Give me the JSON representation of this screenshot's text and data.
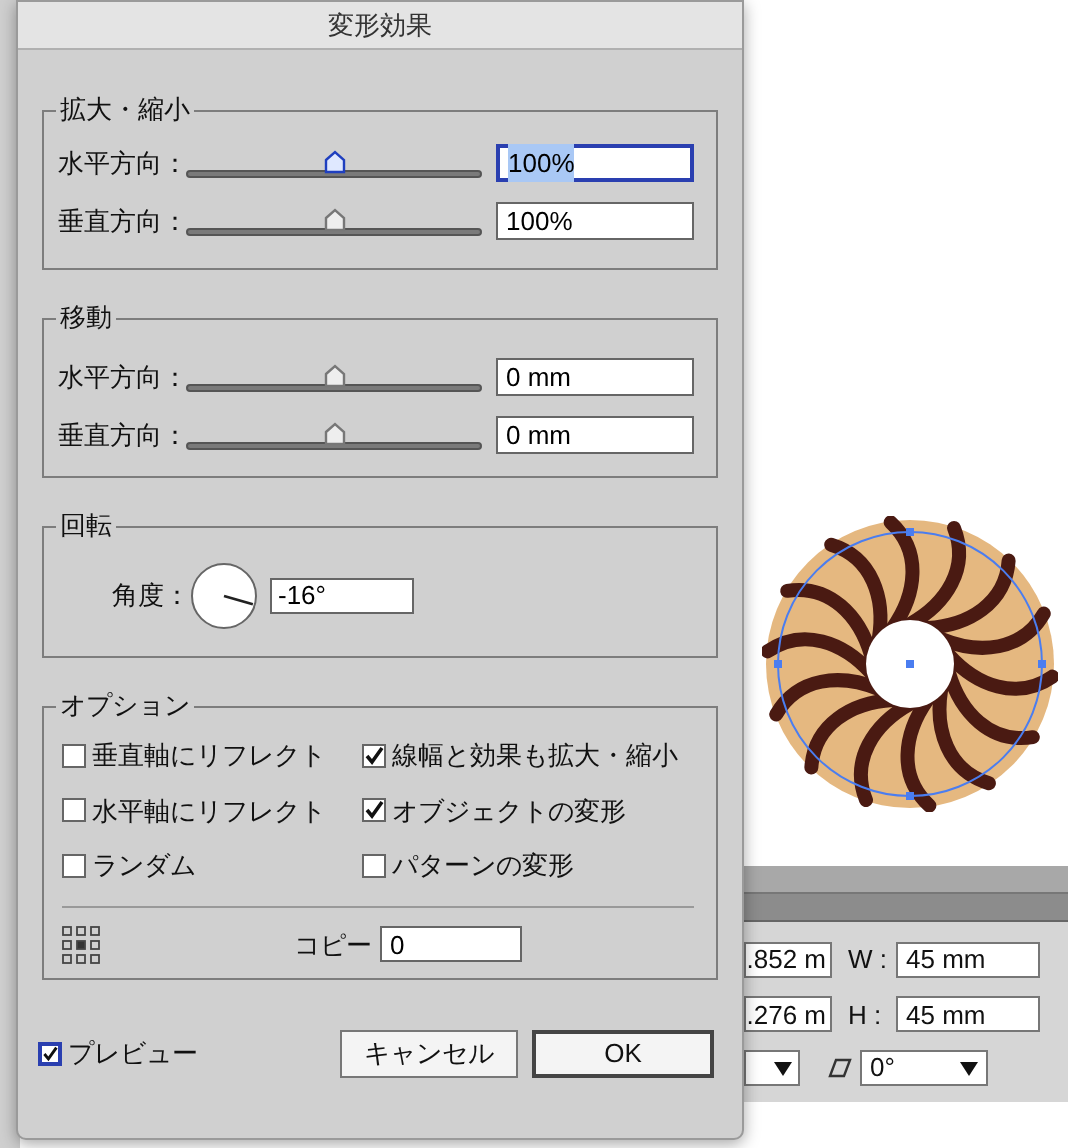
{
  "dialog": {
    "title": "変形効果",
    "scale": {
      "legend": "拡大・縮小",
      "rows": [
        {
          "label": "水平方向：",
          "level": 0.5,
          "value": "100%",
          "focused": true
        },
        {
          "label": "垂直方向：",
          "level": 0.5,
          "value": "100%",
          "focused": false
        }
      ]
    },
    "move": {
      "legend": "移動",
      "rows": [
        {
          "label": "水平方向：",
          "level": 0.5,
          "value": "0 mm",
          "focused": false
        },
        {
          "label": "垂直方向：",
          "level": 0.5,
          "value": "0 mm",
          "focused": false
        }
      ]
    },
    "rotate": {
      "legend": "回転",
      "label": "角度：",
      "value": "-16°"
    },
    "options": {
      "legend": "オプション",
      "checkboxes": [
        {
          "label": "垂直軸にリフレクト",
          "checked": false
        },
        {
          "label": "線幅と効果も拡大・縮小",
          "checked": true
        },
        {
          "label": "水平軸にリフレクト",
          "checked": false
        },
        {
          "label": "オブジェクトの変形",
          "checked": true
        },
        {
          "label": "ランダム",
          "checked": false
        },
        {
          "label": "パターンの変形",
          "checked": false
        }
      ],
      "copy": {
        "label": "コピー",
        "value": "0"
      }
    },
    "preview": {
      "label": "プレビュー",
      "checked": true
    },
    "buttons": [
      {
        "label": "キャンセル",
        "default": false
      },
      {
        "label": "OK",
        "default": true
      }
    ]
  },
  "transform_panel": {
    "x_value": ".852 m",
    "y_value": ".276 m",
    "w_label": "W :",
    "w_value": "45 mm",
    "h_label": "H :",
    "h_value": "45 mm",
    "shear_value": "0°"
  }
}
